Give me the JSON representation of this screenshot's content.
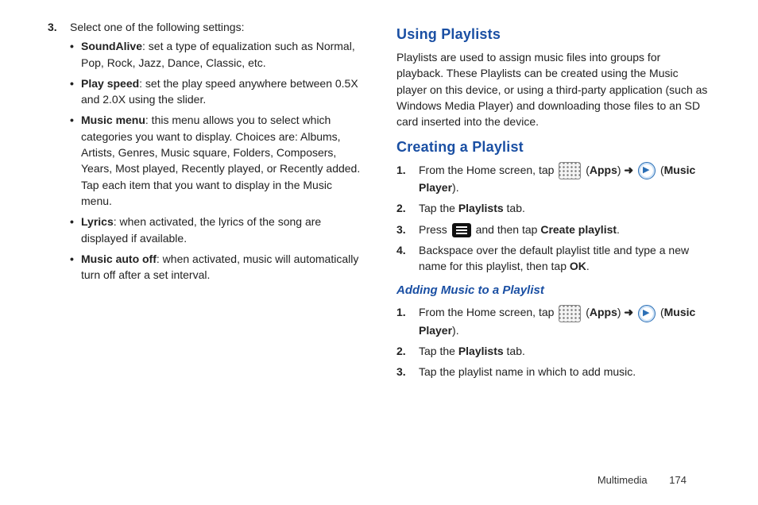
{
  "left": {
    "step3": {
      "num": "3.",
      "intro": "Select one of the following settings:",
      "bullets": [
        {
          "term": "SoundAlive",
          "desc": ": set a type of equalization such as Normal, Pop, Rock, Jazz, Dance, Classic, etc."
        },
        {
          "term": "Play speed",
          "desc": ": set the play speed anywhere between 0.5X and 2.0X using the slider."
        },
        {
          "term": "Music menu",
          "desc": ": this menu allows you to select which categories you want to display. Choices are: Albums, Artists, Genres, Music square, Folders, Composers, Years, Most played, Recently played, or Recently added. Tap each item that you want to display in the Music menu."
        },
        {
          "term": "Lyrics",
          "desc": ": when activated, the lyrics of the song are displayed if available."
        },
        {
          "term": "Music auto off",
          "desc": ": when activated, music will automatically turn off after a set interval."
        }
      ]
    }
  },
  "right": {
    "using_title": "Using Playlists",
    "using_body": "Playlists are used to assign music files into groups for playback. These Playlists can be created using the Music player on this device, or using a third-party application (such as Windows Media Player) and downloading those files to an SD card inserted into the device.",
    "creating_title": "Creating a Playlist",
    "creating_steps": {
      "s1": {
        "num": "1.",
        "pre": "From the Home screen, tap ",
        "apps_label": "Apps",
        "arrow": " ➜ ",
        "music_label": "Music Player",
        "post": ")."
      },
      "s2": {
        "num": "2.",
        "pre": "Tap the ",
        "bold": "Playlists",
        "post": " tab."
      },
      "s3": {
        "num": "3.",
        "pre": "Press ",
        "mid": " and then tap ",
        "bold": "Create playlist",
        "post": "."
      },
      "s4": {
        "num": "4.",
        "pre": "Backspace over the default playlist title and type a new name for this playlist, then tap ",
        "bold": "OK",
        "post": "."
      }
    },
    "adding_title": "Adding Music to a Playlist",
    "adding_steps": {
      "s1": {
        "num": "1.",
        "pre": "From the Home screen, tap ",
        "apps_label": "Apps",
        "arrow": " ➜ ",
        "music_label": "Music Player",
        "post": ")."
      },
      "s2": {
        "num": "2.",
        "pre": "Tap the ",
        "bold": "Playlists",
        "post": " tab."
      },
      "s3": {
        "num": "3.",
        "text": "Tap the playlist name in which to add music."
      }
    }
  },
  "footer": {
    "section": "Multimedia",
    "page": "174"
  }
}
